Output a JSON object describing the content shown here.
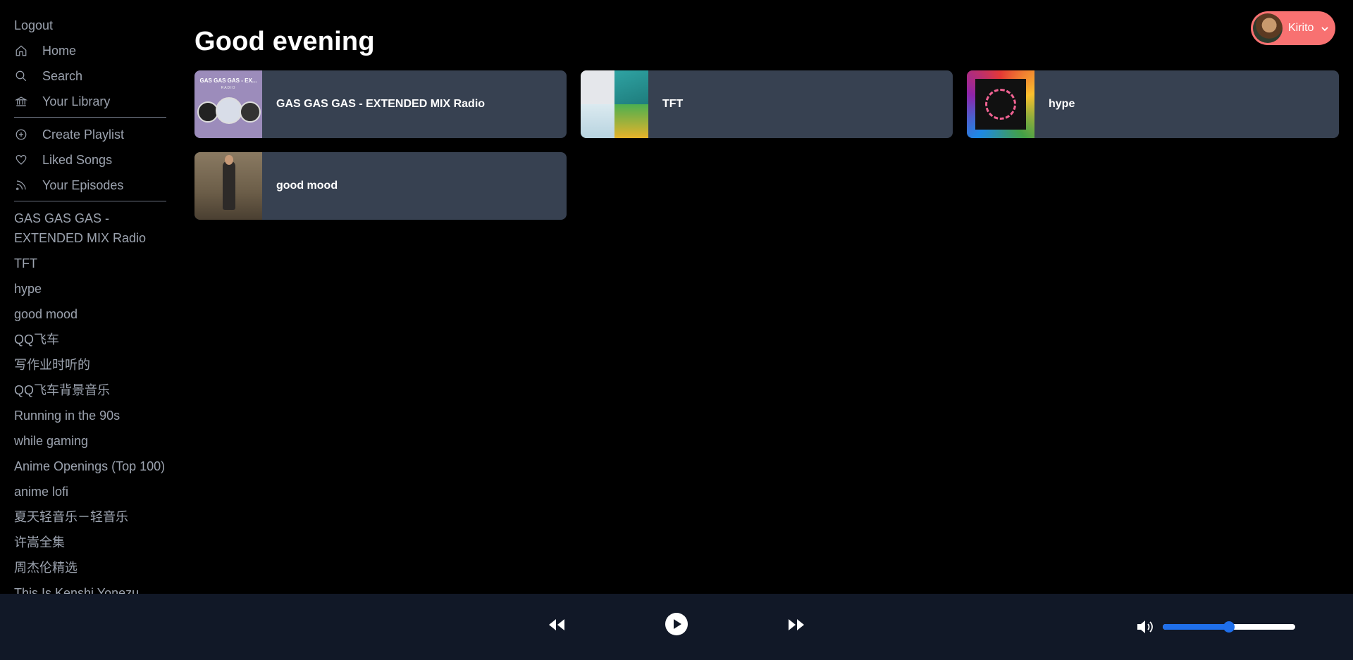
{
  "sidebar": {
    "logout": "Logout",
    "nav": [
      {
        "label": "Home",
        "icon": "home-icon"
      },
      {
        "label": "Search",
        "icon": "search-icon"
      },
      {
        "label": "Your Library",
        "icon": "library-icon"
      }
    ],
    "actions": [
      {
        "label": "Create Playlist",
        "icon": "plus-circle-icon"
      },
      {
        "label": "Liked Songs",
        "icon": "heart-icon"
      },
      {
        "label": "Your Episodes",
        "icon": "rss-icon"
      }
    ],
    "playlists": [
      "GAS GAS GAS - EXTENDED MIX Radio",
      "TFT",
      "hype",
      "good mood",
      "QQ飞车",
      "写作业时听的",
      "QQ飞车背景音乐",
      "Running in the 90s",
      "while gaming",
      "Anime Openings (Top 100)",
      "anime lofi",
      "夏天轻音乐－轻音乐",
      "许嵩全集",
      "周杰伦精选",
      "This Is Kenshi Yonezu"
    ]
  },
  "main": {
    "greeting": "Good evening",
    "user": {
      "name": "Kirito"
    },
    "cards": [
      {
        "title": "GAS GAS GAS - EXTENDED MIX Radio",
        "cover_text": "GAS GAS GAS - EX...",
        "cover_sub": "RADIO"
      },
      {
        "title": "TFT"
      },
      {
        "title": "hype"
      },
      {
        "title": "good mood"
      }
    ]
  },
  "player": {
    "volume_percent": 50
  },
  "colors": {
    "background": "#000000",
    "card": "#374151",
    "player_bar": "#111827",
    "user_pill": "#f87171",
    "slider_accent": "#1f6feb",
    "sidebar_text": "#9ca3af"
  }
}
